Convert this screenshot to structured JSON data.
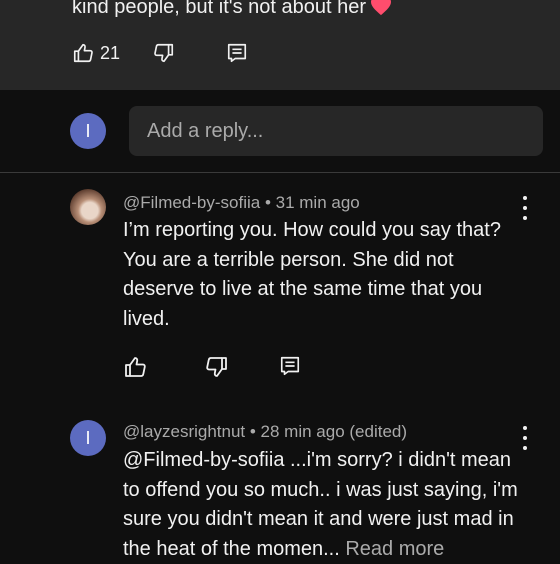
{
  "top_comment": {
    "text_visible": "kind people, but it's not about her",
    "like_count": "21"
  },
  "reply_box": {
    "avatar_letter": "I",
    "placeholder": "Add a reply..."
  },
  "comments": [
    {
      "author": "@Filmed-by-sofiia",
      "meta": " • 31 min ago",
      "text": "I’m reporting you. How could you say that? You are a terrible person. She did not deserve to live at the same time that you lived."
    },
    {
      "author": "@layzesrightnut",
      "meta": " • 28 min ago (edited)",
      "avatar_letter": "I",
      "text": "@Filmed-by-sofiia ...i'm sorry? i didn't mean to offend you so much.. i was just saying, i'm sure you didn't mean it and were just mad in the heat of the momen...",
      "read_more": "Read more"
    }
  ],
  "colors": {
    "background": "#0f0f0f",
    "top_card": "#272727",
    "avatar": "#5c6bc0",
    "heart": "#ff4d6d"
  },
  "icons": [
    "thumbs-up-icon",
    "thumbs-down-icon",
    "reply-icon",
    "kebab-menu-icon",
    "heart-emoji-icon"
  ]
}
